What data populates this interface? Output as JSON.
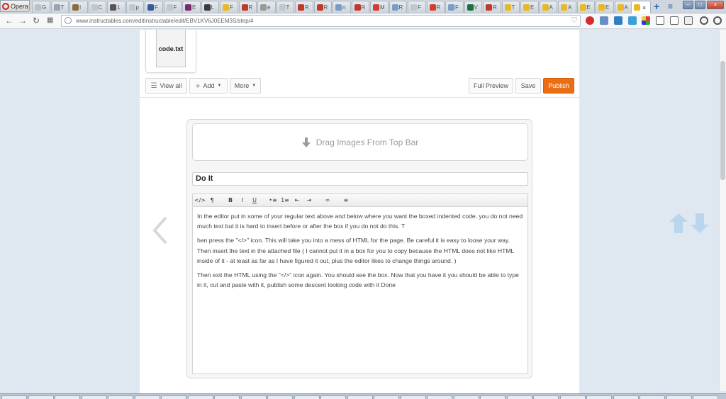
{
  "browser": {
    "brand": "Opera",
    "url": "www.instructables.com/editInstructable/edit/EBV1KV6J0EEM3S/step/4",
    "tabs": [
      {
        "label": "G",
        "color": "#b9c1ca"
      },
      {
        "label": "T",
        "color": "#9aa5b1"
      },
      {
        "label": "I",
        "color": "#8a6d3b"
      },
      {
        "label": "C",
        "color": "#c0c7ce"
      },
      {
        "label": "1",
        "color": "#555"
      },
      {
        "label": "p",
        "color": "#c0c7ce"
      },
      {
        "label": "F",
        "color": "#3b5998"
      },
      {
        "label": "F",
        "color": "#c0c7ce"
      },
      {
        "label": "E",
        "color": "#7a2a6f"
      },
      {
        "label": "L",
        "color": "#3a3a3a"
      },
      {
        "label": "F",
        "color": "#e8b923"
      },
      {
        "label": "R",
        "color": "#c0392b"
      },
      {
        "label": "e",
        "color": "#999"
      },
      {
        "label": "T",
        "color": "#c0c7ce"
      },
      {
        "label": "R",
        "color": "#c0392b"
      },
      {
        "label": "R",
        "color": "#c0392b"
      },
      {
        "label": "n",
        "color": "#7a9cc6"
      },
      {
        "label": "R",
        "color": "#c0392b"
      },
      {
        "label": "M",
        "color": "#d43c2f"
      },
      {
        "label": "R",
        "color": "#7a9cc6"
      },
      {
        "label": "F",
        "color": "#c0c7ce"
      },
      {
        "label": "R",
        "color": "#d43c2f"
      },
      {
        "label": "F",
        "color": "#7a9cc6"
      },
      {
        "label": "V",
        "color": "#1d6f42"
      },
      {
        "label": "R",
        "color": "#c0392b"
      },
      {
        "label": "T",
        "color": "#e8b923"
      },
      {
        "label": "E",
        "color": "#e8b923"
      },
      {
        "label": "A",
        "color": "#e8b923"
      },
      {
        "label": "A",
        "color": "#e8b923"
      },
      {
        "label": "E",
        "color": "#e8b923"
      },
      {
        "label": "E",
        "color": "#e8b923"
      },
      {
        "label": "A",
        "color": "#e8b923"
      },
      {
        "label": "A",
        "color": "#e8b923"
      }
    ],
    "active_tab": {
      "label": "",
      "close": "×"
    },
    "new_tab": "+",
    "menu": "≡",
    "window_buttons": [
      "–",
      "□",
      "×"
    ]
  },
  "editor": {
    "file_name": "code.txt",
    "toolbar": {
      "view_all": "View all",
      "add": "Add",
      "more": "More",
      "full_preview": "Full Preview",
      "save": "Save",
      "publish": "Publish"
    },
    "drop_zone": "Drag Images From Top Bar",
    "step_title": "Do It",
    "rte_buttons": [
      "</>",
      "¶",
      "B",
      "I",
      "U",
      "•≡",
      "1≡",
      "⇤",
      "⇥",
      "∞",
      "≡"
    ],
    "body": [
      "In the editor put in some of your regular text above and below where you want the boxed indented code, you do not need much text but it is hard to insert before or after the box if you do not do this. T",
      "hen press the \"</>\" icon.  This will take you into a mess of HTML for the page.  Be careful it is easy to loose your way.  Then insert the text in the attached file ( I cannot put it in a box for you to copy because the HTML does not like HTML inside of it - at least as far as I have figured it out, plus the editor likes to change things around. )",
      "Then exit the HTML using the \"</>\" icon again.  You should see the box.  Now that you have it you should be able to type in it, cut and paste with it, publish some descent looking code with it  Done"
    ]
  },
  "colors": {
    "publish": "#ec6e14",
    "page_bg": "#dfe8f1",
    "side_arrows": "#b9d6ee"
  }
}
